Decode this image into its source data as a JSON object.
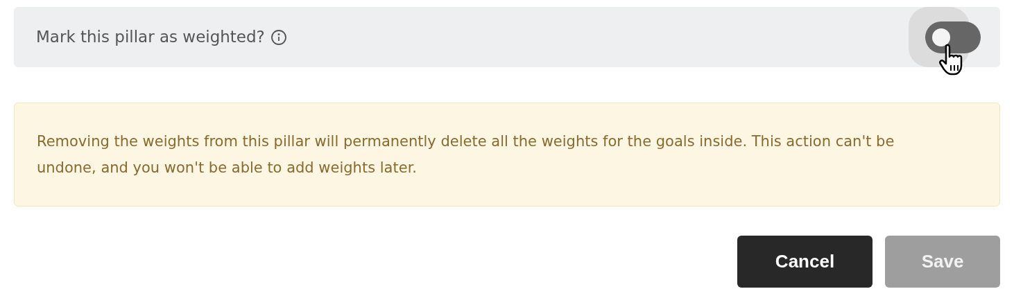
{
  "toggle_row": {
    "label": "Mark this pillar as weighted?",
    "on": false
  },
  "warning": {
    "text": "Removing the weights from this pillar will permanently delete all the weights for the goals inside. This action can't be undone, and you won't be able to add weights later."
  },
  "buttons": [
    {
      "kind": "secondary",
      "label": "Cancel",
      "disabled": false
    },
    {
      "kind": "primary",
      "label": "Save",
      "disabled": true
    }
  ]
}
